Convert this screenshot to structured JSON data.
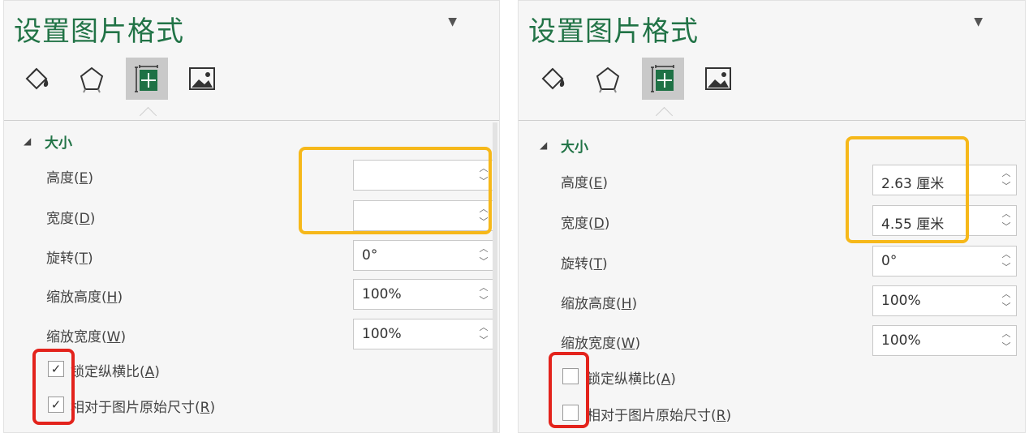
{
  "colors": {
    "accent": "#217346",
    "highlight_yellow": "#f6b81a",
    "highlight_red": "#e3231c"
  },
  "panels": [
    {
      "title": "设置图片格式",
      "section": "大小",
      "fields": [
        {
          "label": "高度(",
          "key": "E",
          "value": ""
        },
        {
          "label": "宽度(",
          "key": "D",
          "value": ""
        },
        {
          "label": "旋转(",
          "key": "T",
          "value": "0°"
        },
        {
          "label": "缩放高度(",
          "key": "H",
          "value": "100%"
        },
        {
          "label": "缩放宽度(",
          "key": "W",
          "value": "100%"
        }
      ],
      "checkboxes": [
        {
          "label": "锁定纵横比(",
          "key": "A",
          "mark": "✓",
          "checked": true
        },
        {
          "label": "相对于图片原始尺寸(",
          "key": "R",
          "mark": "✓",
          "checked": true
        }
      ]
    },
    {
      "title": "设置图片格式",
      "section": "大小",
      "fields": [
        {
          "label": "高度(",
          "key": "E",
          "value": "2.63 厘米"
        },
        {
          "label": "宽度(",
          "key": "D",
          "value": "4.55 厘米"
        },
        {
          "label": "旋转(",
          "key": "T",
          "value": "0°"
        },
        {
          "label": "缩放高度(",
          "key": "H",
          "value": "100%"
        },
        {
          "label": "缩放宽度(",
          "key": "W",
          "value": "100%"
        }
      ],
      "checkboxes": [
        {
          "label": "锁定纵横比(",
          "key": "A",
          "mark": "",
          "checked": false
        },
        {
          "label": "相对于图片原始尺寸(",
          "key": "R",
          "mark": "",
          "checked": false
        }
      ]
    }
  ],
  "icons": {
    "dropdown": "dropdown-arrow-icon",
    "tabs": [
      "fill-line-icon",
      "effects-icon",
      "size-properties-icon",
      "picture-icon"
    ],
    "section_collapse": "collapse-triangle-icon",
    "spin_up": "spin-up-icon",
    "spin_down": "spin-down-icon",
    "check": "checkmark-icon"
  }
}
